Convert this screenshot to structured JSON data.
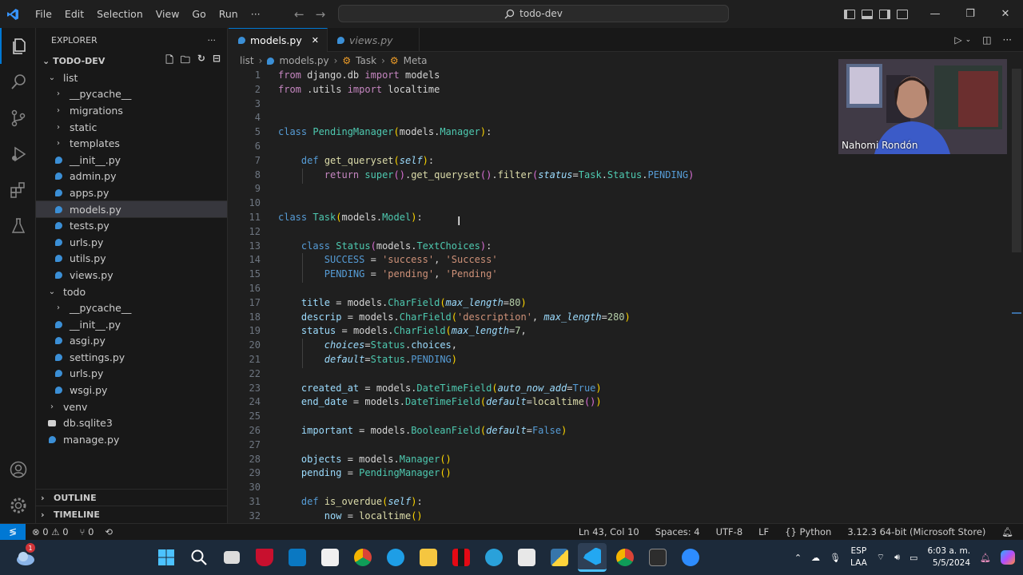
{
  "titlebar": {
    "menu": [
      "File",
      "Edit",
      "Selection",
      "View",
      "Go",
      "Run",
      "···"
    ],
    "search": "todo-dev"
  },
  "explorer": {
    "title": "EXPLORER",
    "more": "···",
    "root": "TODO-DEV",
    "tree": [
      {
        "label": "list",
        "depth": 1,
        "type": "folder-open"
      },
      {
        "label": "__pycache__",
        "depth": 2,
        "type": "folder"
      },
      {
        "label": "migrations",
        "depth": 2,
        "type": "folder"
      },
      {
        "label": "static",
        "depth": 2,
        "type": "folder"
      },
      {
        "label": "templates",
        "depth": 2,
        "type": "folder"
      },
      {
        "label": "__init__.py",
        "depth": 2,
        "type": "py"
      },
      {
        "label": "admin.py",
        "depth": 2,
        "type": "py"
      },
      {
        "label": "apps.py",
        "depth": 2,
        "type": "py"
      },
      {
        "label": "models.py",
        "depth": 2,
        "type": "py",
        "selected": true
      },
      {
        "label": "tests.py",
        "depth": 2,
        "type": "py"
      },
      {
        "label": "urls.py",
        "depth": 2,
        "type": "py"
      },
      {
        "label": "utils.py",
        "depth": 2,
        "type": "py"
      },
      {
        "label": "views.py",
        "depth": 2,
        "type": "py"
      },
      {
        "label": "todo",
        "depth": 1,
        "type": "folder-open"
      },
      {
        "label": "__pycache__",
        "depth": 2,
        "type": "folder"
      },
      {
        "label": "__init__.py",
        "depth": 2,
        "type": "py"
      },
      {
        "label": "asgi.py",
        "depth": 2,
        "type": "py"
      },
      {
        "label": "settings.py",
        "depth": 2,
        "type": "py"
      },
      {
        "label": "urls.py",
        "depth": 2,
        "type": "py"
      },
      {
        "label": "wsgi.py",
        "depth": 2,
        "type": "py"
      },
      {
        "label": "venv",
        "depth": 1,
        "type": "folder"
      },
      {
        "label": "db.sqlite3",
        "depth": 1,
        "type": "db"
      },
      {
        "label": "manage.py",
        "depth": 1,
        "type": "py"
      }
    ],
    "outline": "OUTLINE",
    "timeline": "TIMELINE"
  },
  "tabs": [
    {
      "label": "models.py",
      "active": true,
      "close": "✕"
    },
    {
      "label": "views.py",
      "active": false
    }
  ],
  "breadcrumb": [
    "list",
    "models.py",
    "Task",
    "Meta"
  ],
  "code": [
    {
      "n": "1",
      "t": [
        [
          "k",
          "from"
        ],
        [
          "d",
          " django.db "
        ],
        [
          "k",
          "import"
        ],
        [
          "d",
          " models"
        ]
      ]
    },
    {
      "n": "2",
      "t": [
        [
          "k",
          "from"
        ],
        [
          "d",
          " .utils "
        ],
        [
          "k",
          "import"
        ],
        [
          "d",
          " localtime"
        ]
      ]
    },
    {
      "n": "3",
      "t": []
    },
    {
      "n": "4",
      "t": []
    },
    {
      "n": "5",
      "t": [
        [
          "kb",
          "class"
        ],
        [
          "d",
          " "
        ],
        [
          "c",
          "PendingManager"
        ],
        [
          "y",
          "("
        ],
        [
          "d",
          "models."
        ],
        [
          "c",
          "Manager"
        ],
        [
          "y",
          ")"
        ],
        [
          "d",
          ":"
        ]
      ]
    },
    {
      "n": "6",
      "t": []
    },
    {
      "n": "7",
      "t": [
        [
          "d",
          "    "
        ],
        [
          "kb",
          "def"
        ],
        [
          "d",
          " "
        ],
        [
          "f",
          "get_queryset"
        ],
        [
          "y",
          "("
        ],
        [
          "sf",
          "self"
        ],
        [
          "y",
          ")"
        ],
        [
          "d",
          ":"
        ]
      ]
    },
    {
      "n": "8",
      "t": [
        [
          "d",
          "        "
        ],
        [
          "k",
          "return"
        ],
        [
          "d",
          " "
        ],
        [
          "c",
          "super"
        ],
        [
          "pk",
          "()"
        ],
        [
          "d",
          "."
        ],
        [
          "f",
          "get_queryset"
        ],
        [
          "pk",
          "()"
        ],
        [
          "d",
          "."
        ],
        [
          "f",
          "filter"
        ],
        [
          "pk",
          "("
        ],
        [
          "it",
          "status"
        ],
        [
          "d",
          "="
        ],
        [
          "c",
          "Task"
        ],
        [
          "d",
          "."
        ],
        [
          "c",
          "Status"
        ],
        [
          "d",
          "."
        ],
        [
          "kb",
          "PENDING"
        ],
        [
          "pk",
          ")"
        ]
      ]
    },
    {
      "n": "9",
      "t": []
    },
    {
      "n": "10",
      "t": []
    },
    {
      "n": "11",
      "t": [
        [
          "kb",
          "class"
        ],
        [
          "d",
          " "
        ],
        [
          "c",
          "Task"
        ],
        [
          "y",
          "("
        ],
        [
          "d",
          "models."
        ],
        [
          "c",
          "Model"
        ],
        [
          "y",
          ")"
        ],
        [
          "d",
          ":"
        ]
      ]
    },
    {
      "n": "12",
      "t": []
    },
    {
      "n": "13",
      "t": [
        [
          "d",
          "    "
        ],
        [
          "kb",
          "class"
        ],
        [
          "d",
          " "
        ],
        [
          "c",
          "Status"
        ],
        [
          "pk",
          "("
        ],
        [
          "d",
          "models."
        ],
        [
          "c",
          "TextChoices"
        ],
        [
          "pk",
          ")"
        ],
        [
          "d",
          ":"
        ]
      ]
    },
    {
      "n": "14",
      "t": [
        [
          "d",
          "        "
        ],
        [
          "kb",
          "SUCCESS"
        ],
        [
          "d",
          " = "
        ],
        [
          "s",
          "'success'"
        ],
        [
          "d",
          ", "
        ],
        [
          "s",
          "'Success'"
        ]
      ]
    },
    {
      "n": "15",
      "t": [
        [
          "d",
          "        "
        ],
        [
          "kb",
          "PENDING"
        ],
        [
          "d",
          " = "
        ],
        [
          "s",
          "'pending'"
        ],
        [
          "d",
          ", "
        ],
        [
          "s",
          "'Pending'"
        ]
      ]
    },
    {
      "n": "16",
      "t": []
    },
    {
      "n": "17",
      "t": [
        [
          "d",
          "    "
        ],
        [
          "p",
          "title"
        ],
        [
          "d",
          " = models."
        ],
        [
          "c",
          "CharField"
        ],
        [
          "y",
          "("
        ],
        [
          "it",
          "max_length"
        ],
        [
          "d",
          "="
        ],
        [
          "n",
          "80"
        ],
        [
          "y",
          ")"
        ]
      ]
    },
    {
      "n": "18",
      "t": [
        [
          "d",
          "    "
        ],
        [
          "p",
          "descrip"
        ],
        [
          "d",
          " = models."
        ],
        [
          "c",
          "CharField"
        ],
        [
          "y",
          "("
        ],
        [
          "s",
          "'description'"
        ],
        [
          "d",
          ", "
        ],
        [
          "it",
          "max_length"
        ],
        [
          "d",
          "="
        ],
        [
          "n",
          "280"
        ],
        [
          "y",
          ")"
        ]
      ]
    },
    {
      "n": "19",
      "t": [
        [
          "d",
          "    "
        ],
        [
          "p",
          "status"
        ],
        [
          "d",
          " = models."
        ],
        [
          "c",
          "CharField"
        ],
        [
          "y",
          "("
        ],
        [
          "it",
          "max_length"
        ],
        [
          "d",
          "="
        ],
        [
          "n",
          "7"
        ],
        [
          "d",
          ","
        ]
      ]
    },
    {
      "n": "20",
      "t": [
        [
          "d",
          "        "
        ],
        [
          "it",
          "choices"
        ],
        [
          "d",
          "="
        ],
        [
          "c",
          "Status"
        ],
        [
          "d",
          "."
        ],
        [
          "p",
          "choices"
        ],
        [
          "d",
          ","
        ]
      ]
    },
    {
      "n": "21",
      "t": [
        [
          "d",
          "        "
        ],
        [
          "it",
          "default"
        ],
        [
          "d",
          "="
        ],
        [
          "c",
          "Status"
        ],
        [
          "d",
          "."
        ],
        [
          "kb",
          "PENDING"
        ],
        [
          "y",
          ")"
        ]
      ]
    },
    {
      "n": "22",
      "t": []
    },
    {
      "n": "23",
      "t": [
        [
          "d",
          "    "
        ],
        [
          "p",
          "created_at"
        ],
        [
          "d",
          " = models."
        ],
        [
          "c",
          "DateTimeField"
        ],
        [
          "y",
          "("
        ],
        [
          "it",
          "auto_now_add"
        ],
        [
          "d",
          "="
        ],
        [
          "kb",
          "True"
        ],
        [
          "y",
          ")"
        ]
      ]
    },
    {
      "n": "24",
      "t": [
        [
          "d",
          "    "
        ],
        [
          "p",
          "end_date"
        ],
        [
          "d",
          " = models."
        ],
        [
          "c",
          "DateTimeField"
        ],
        [
          "y",
          "("
        ],
        [
          "it",
          "default"
        ],
        [
          "d",
          "="
        ],
        [
          "f",
          "localtime"
        ],
        [
          "pk",
          "()"
        ],
        [
          "y",
          ")"
        ]
      ]
    },
    {
      "n": "25",
      "t": []
    },
    {
      "n": "26",
      "t": [
        [
          "d",
          "    "
        ],
        [
          "p",
          "important"
        ],
        [
          "d",
          " = models."
        ],
        [
          "c",
          "BooleanField"
        ],
        [
          "y",
          "("
        ],
        [
          "it",
          "default"
        ],
        [
          "d",
          "="
        ],
        [
          "kb",
          "False"
        ],
        [
          "y",
          ")"
        ]
      ]
    },
    {
      "n": "27",
      "t": []
    },
    {
      "n": "28",
      "t": [
        [
          "d",
          "    "
        ],
        [
          "p",
          "objects"
        ],
        [
          "d",
          " = models."
        ],
        [
          "c",
          "Manager"
        ],
        [
          "y",
          "()"
        ]
      ]
    },
    {
      "n": "29",
      "t": [
        [
          "d",
          "    "
        ],
        [
          "p",
          "pending"
        ],
        [
          "d",
          " = "
        ],
        [
          "c",
          "PendingManager"
        ],
        [
          "y",
          "()"
        ]
      ]
    },
    {
      "n": "30",
      "t": []
    },
    {
      "n": "31",
      "t": [
        [
          "d",
          "    "
        ],
        [
          "kb",
          "def"
        ],
        [
          "d",
          " "
        ],
        [
          "f",
          "is_overdue"
        ],
        [
          "y",
          "("
        ],
        [
          "sf",
          "self"
        ],
        [
          "y",
          ")"
        ],
        [
          "d",
          ":"
        ]
      ]
    },
    {
      "n": "32",
      "t": [
        [
          "d",
          "        "
        ],
        [
          "p",
          "now"
        ],
        [
          "d",
          " = "
        ],
        [
          "f",
          "localtime"
        ],
        [
          "y",
          "()"
        ]
      ]
    }
  ],
  "webcam": {
    "name": "Nahomi Rondón"
  },
  "statusbar": {
    "errors": "⊗ 0 ⚠ 0",
    "ports": "⑂ 0",
    "position": "Ln 43, Col 10",
    "spaces": "Spaces: 4",
    "encoding": "UTF-8",
    "eol": "LF",
    "language": "Python",
    "interpreter": "3.12.3 64-bit (Microsoft Store)"
  },
  "taskbar": {
    "lang_top": "ESP",
    "lang_bottom": "LAA",
    "time": "6:03 a. m.",
    "date": "5/5/2024",
    "weather_badge": "1",
    "apps": [
      "start",
      "search",
      "files",
      "mcafee",
      "mysql",
      "store",
      "chrome",
      "edge",
      "explorer",
      "netflix",
      "telegram",
      "notes",
      "python",
      "vscode",
      "chrome-2",
      "terminal",
      "zoom"
    ]
  },
  "colors": {
    "accent": "#0078d4",
    "editor_bg": "#1f1f1f",
    "sidebar_bg": "#181818",
    "taskbar_bg": "#1c2a3a"
  }
}
